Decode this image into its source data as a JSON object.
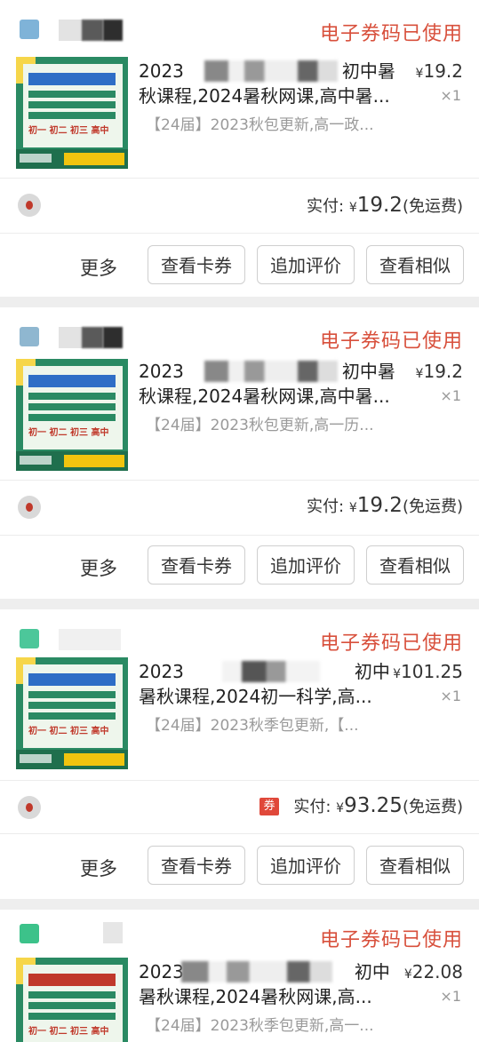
{
  "orders": [
    {
      "status": "电子券码已使用",
      "title_line1": "2023",
      "title_line1_end": "初中暑",
      "title_line2": "秋课程,2024暑秋网课,高中暑...",
      "price_symbol": "¥",
      "price": "19.2",
      "qty": "×1",
      "spec": "【24届】2023秋包更新,高一政...",
      "paid_label": "实付:",
      "paid_symbol": "¥",
      "paid_amount": "19.2",
      "shipping": "(免运费)",
      "more": "更多",
      "btn_view_coupon": "查看卡券",
      "btn_add_review": "追加评价",
      "btn_similar": "查看相似",
      "thumb_grades": "初一 初二 初三 高中"
    },
    {
      "status": "电子券码已使用",
      "title_line1": "2023",
      "title_line1_end": "初中暑",
      "title_line2": "秋课程,2024暑秋网课,高中暑...",
      "price_symbol": "¥",
      "price": "19.2",
      "qty": "×1",
      "spec": "【24届】2023秋包更新,高一历...",
      "paid_label": "实付:",
      "paid_symbol": "¥",
      "paid_amount": "19.2",
      "shipping": "(免运费)",
      "more": "更多",
      "btn_view_coupon": "查看卡券",
      "btn_add_review": "追加评价",
      "btn_similar": "查看相似",
      "thumb_grades": "初一 初二 初三 高中"
    },
    {
      "status": "电子券码已使用",
      "title_line1": "2023",
      "title_line1_end": "初中",
      "title_line2": "暑秋课程,2024初一科学,高...",
      "price_symbol": "¥",
      "price": "101.25",
      "qty": "×1",
      "spec": "【24届】2023秋季包更新,【...",
      "coupon_badge": "券",
      "paid_label": "实付:",
      "paid_symbol": "¥",
      "paid_amount": "93.25",
      "shipping": "(免运费)",
      "more": "更多",
      "btn_view_coupon": "查看卡券",
      "btn_add_review": "追加评价",
      "btn_similar": "查看相似",
      "thumb_grades": "初一 初二 初三 高中"
    },
    {
      "status": "电子券码已使用",
      "title_line1": "2023",
      "title_line1_end": "初中",
      "title_line2": "暑秋课程,2024暑秋网课,高...",
      "price_symbol": "¥",
      "price": "22.08",
      "qty": "×1",
      "spec": "【24届】2023秋季包更新,高一...",
      "thumb_grades": "初一 初二 初三 高中"
    }
  ],
  "colors": {
    "status_red": "#d8503c",
    "thumb_green": "#2a8a63",
    "coupon_red": "#e0483a"
  }
}
